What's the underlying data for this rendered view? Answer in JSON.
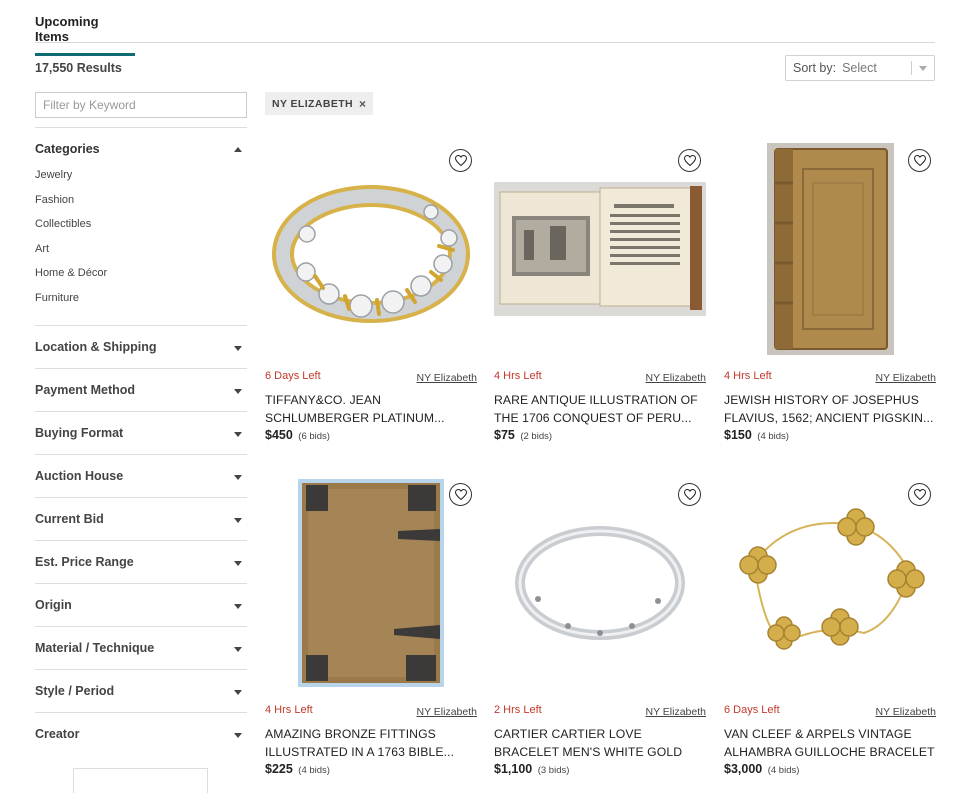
{
  "header": {
    "active_tab": "Upcoming Items"
  },
  "results": {
    "count_text": "17,550 Results"
  },
  "sort": {
    "label": "Sort by:",
    "value": "Select"
  },
  "filter": {
    "keyword_placeholder": "Filter by Keyword",
    "categories_title": "Categories",
    "categories": [
      "Jewelry",
      "Fashion",
      "Collectibles",
      "Art",
      "Home & Décor",
      "Furniture"
    ],
    "sections": [
      "Location & Shipping",
      "Payment Method",
      "Buying Format",
      "Auction House",
      "Current Bid",
      "Est. Price Range",
      "Origin",
      "Material / Technique",
      "Style / Period",
      "Creator"
    ]
  },
  "active_filter": {
    "label": "NY ELIZABETH",
    "remove": "×"
  },
  "items": [
    {
      "time_left": "6 Days Left",
      "house": "NY Elizabeth",
      "title": "TIFFANY&CO. JEAN SCHLUMBERGER PLATINUM...",
      "price": "$450",
      "bids": "(6 bids)"
    },
    {
      "time_left": "4 Hrs Left",
      "house": "NY Elizabeth",
      "title": "RARE ANTIQUE ILLUSTRATION OF THE 1706 CONQUEST OF PERU...",
      "price": "$75",
      "bids": "(2 bids)"
    },
    {
      "time_left": "4 Hrs Left",
      "house": "NY Elizabeth",
      "title": "JEWISH HISTORY OF JOSEPHUS FLAVIUS, 1562; ANCIENT PIGSKIN...",
      "price": "$150",
      "bids": "(4 bids)"
    },
    {
      "time_left": "4 Hrs Left",
      "house": "NY Elizabeth",
      "title": "AMAZING BRONZE FITTINGS ILLUSTRATED IN A 1763 BIBLE...",
      "price": "$225",
      "bids": "(4 bids)"
    },
    {
      "time_left": "2 Hrs Left",
      "house": "NY Elizabeth",
      "title": "CARTIER CARTIER LOVE BRACELET MEN'S WHITE GOLD",
      "price": "$1,100",
      "bids": "(3 bids)"
    },
    {
      "time_left": "6 Days Left",
      "house": "NY Elizabeth",
      "title": "VAN CLEEF & ARPELS VINTAGE ALHAMBRA GUILLOCHE BRACELET",
      "price": "$3,000",
      "bids": "(4 bids)"
    }
  ],
  "icons": {
    "favorite": "heart-icon",
    "expand": "chevron-down-icon",
    "collapse": "chevron-up-icon"
  },
  "colors": {
    "accent": "#0f6b73",
    "time_left": "#c0392b"
  }
}
